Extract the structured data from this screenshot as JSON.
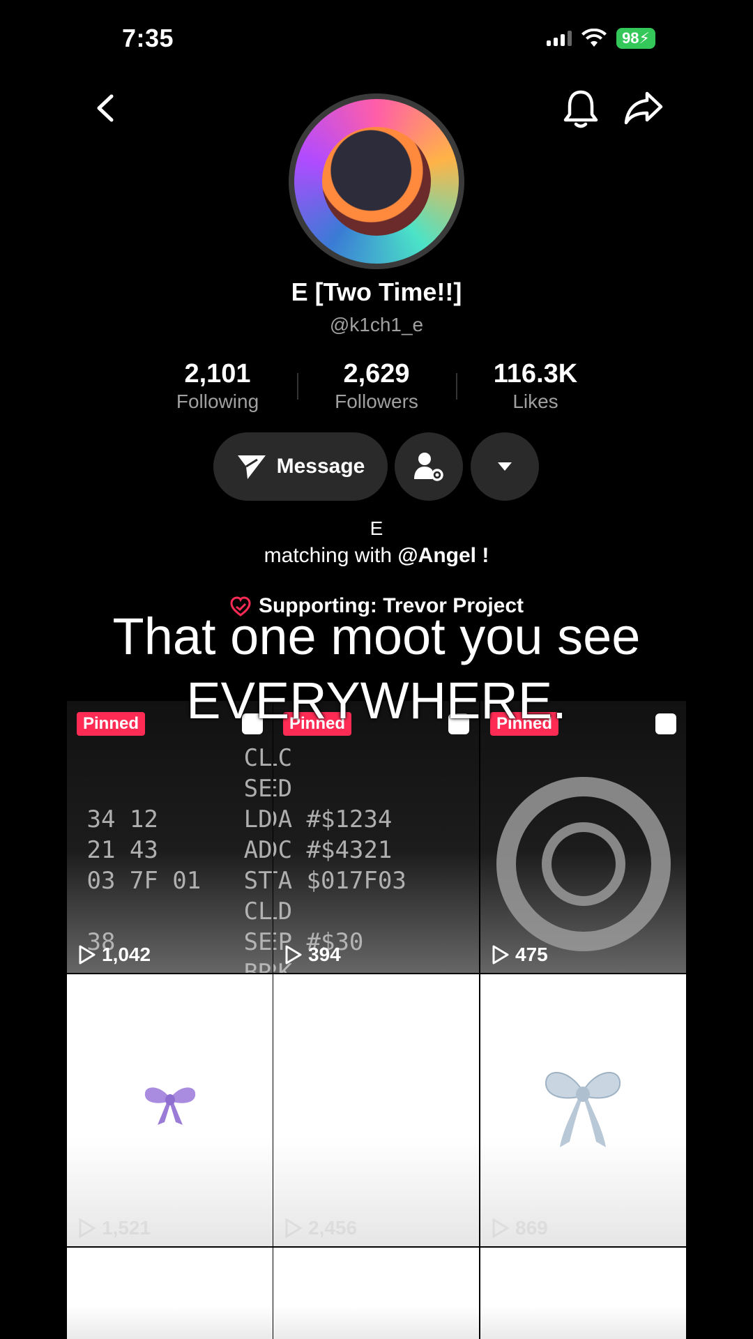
{
  "status": {
    "time": "7:35",
    "battery": "98"
  },
  "profile": {
    "display_name": "E [Two Time!!]",
    "handle": "@k1ch1_e"
  },
  "stats": [
    {
      "value": "2,101",
      "label": "Following"
    },
    {
      "value": "2,629",
      "label": "Followers"
    },
    {
      "value": "116.3K",
      "label": "Likes"
    }
  ],
  "actions": {
    "message_label": "Message"
  },
  "bio": {
    "line1": "E",
    "line2_prefix": "matching with ",
    "line2_mention": "@Angel",
    "line2_suffix": " !"
  },
  "supporting": {
    "text": "Supporting: Trevor Project"
  },
  "caption": {
    "line1": "That one moot you see",
    "line2": "EVERYWHERE."
  },
  "videos": [
    {
      "pinned": "Pinned",
      "views": "1,042"
    },
    {
      "pinned": "Pinned",
      "views": "394"
    },
    {
      "pinned": "Pinned",
      "views": "475"
    },
    {
      "views": "1,521"
    },
    {
      "views": "2,456"
    },
    {
      "views": "869"
    }
  ],
  "colors": {
    "accent": "#fe2c55",
    "battery": "#34c759",
    "button_bg": "#2a2a2a"
  }
}
